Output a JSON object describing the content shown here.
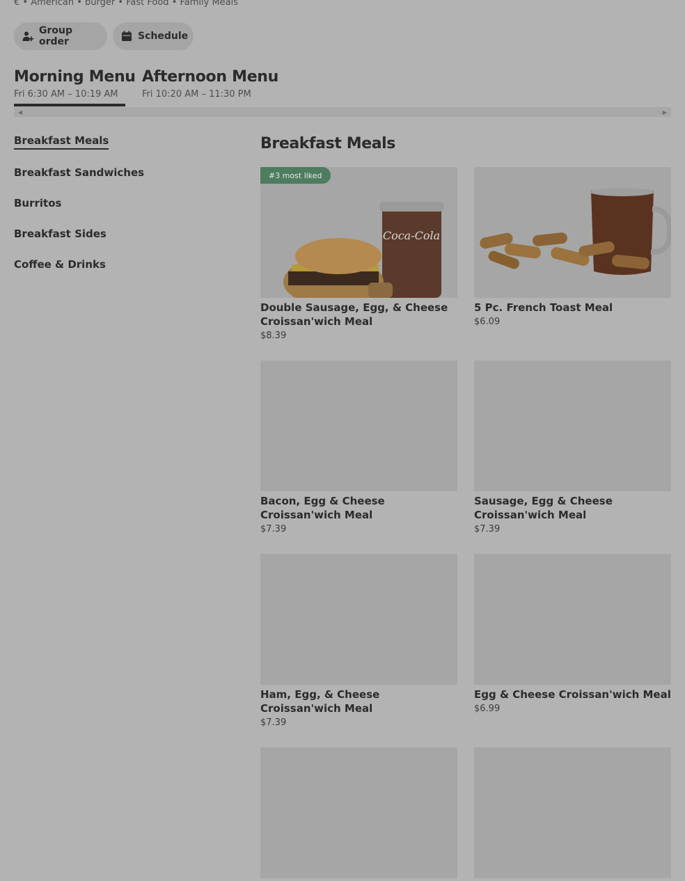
{
  "store": {
    "tags": "€ • American • burger • Fast Food • Family Meals"
  },
  "actions": {
    "group_order": "Group order",
    "schedule": "Schedule"
  },
  "menus": [
    {
      "name": "Morning Menu",
      "hours": "Fri 6:30 AM – 10:19 AM",
      "selected": true
    },
    {
      "name": "Afternoon Menu",
      "hours": "Fri 10:20 AM – 11:30 PM",
      "selected": false
    }
  ],
  "sidebar": {
    "items": [
      {
        "label": "Breakfast Meals",
        "active": true
      },
      {
        "label": "Breakfast Sandwiches",
        "active": false
      },
      {
        "label": "Burritos",
        "active": false
      },
      {
        "label": "Breakfast Sides",
        "active": false
      },
      {
        "label": "Coffee & Drinks",
        "active": false
      }
    ]
  },
  "section": {
    "title": "Breakfast Meals"
  },
  "items": [
    {
      "title": "Double Sausage, Egg, & Cheese Croissan'wich Meal",
      "price": "$8.39",
      "badge": "#3 most liked"
    },
    {
      "title": "5 Pc. French Toast Meal",
      "price": "$6.09"
    },
    {
      "title": "Bacon, Egg & Cheese Croissan'wich Meal",
      "price": "$7.39"
    },
    {
      "title": "Sausage, Egg & Cheese Croissan'wich Meal",
      "price": "$7.39"
    },
    {
      "title": "Ham, Egg, & Cheese Croissan'wich Meal",
      "price": "$7.39"
    },
    {
      "title": "Egg & Cheese Croissan'wich Meal",
      "price": "$6.99"
    },
    {
      "title": "",
      "price": ""
    },
    {
      "title": "",
      "price": ""
    }
  ],
  "colors": {
    "overlay_background": "#b3b3b3",
    "badge": "#4d7c5e",
    "text": "#2b2b2b"
  },
  "icons": {
    "group_order": "add-person-icon",
    "schedule": "calendar-icon",
    "scroll_left": "chevron-left-icon",
    "scroll_right": "chevron-right-icon"
  }
}
